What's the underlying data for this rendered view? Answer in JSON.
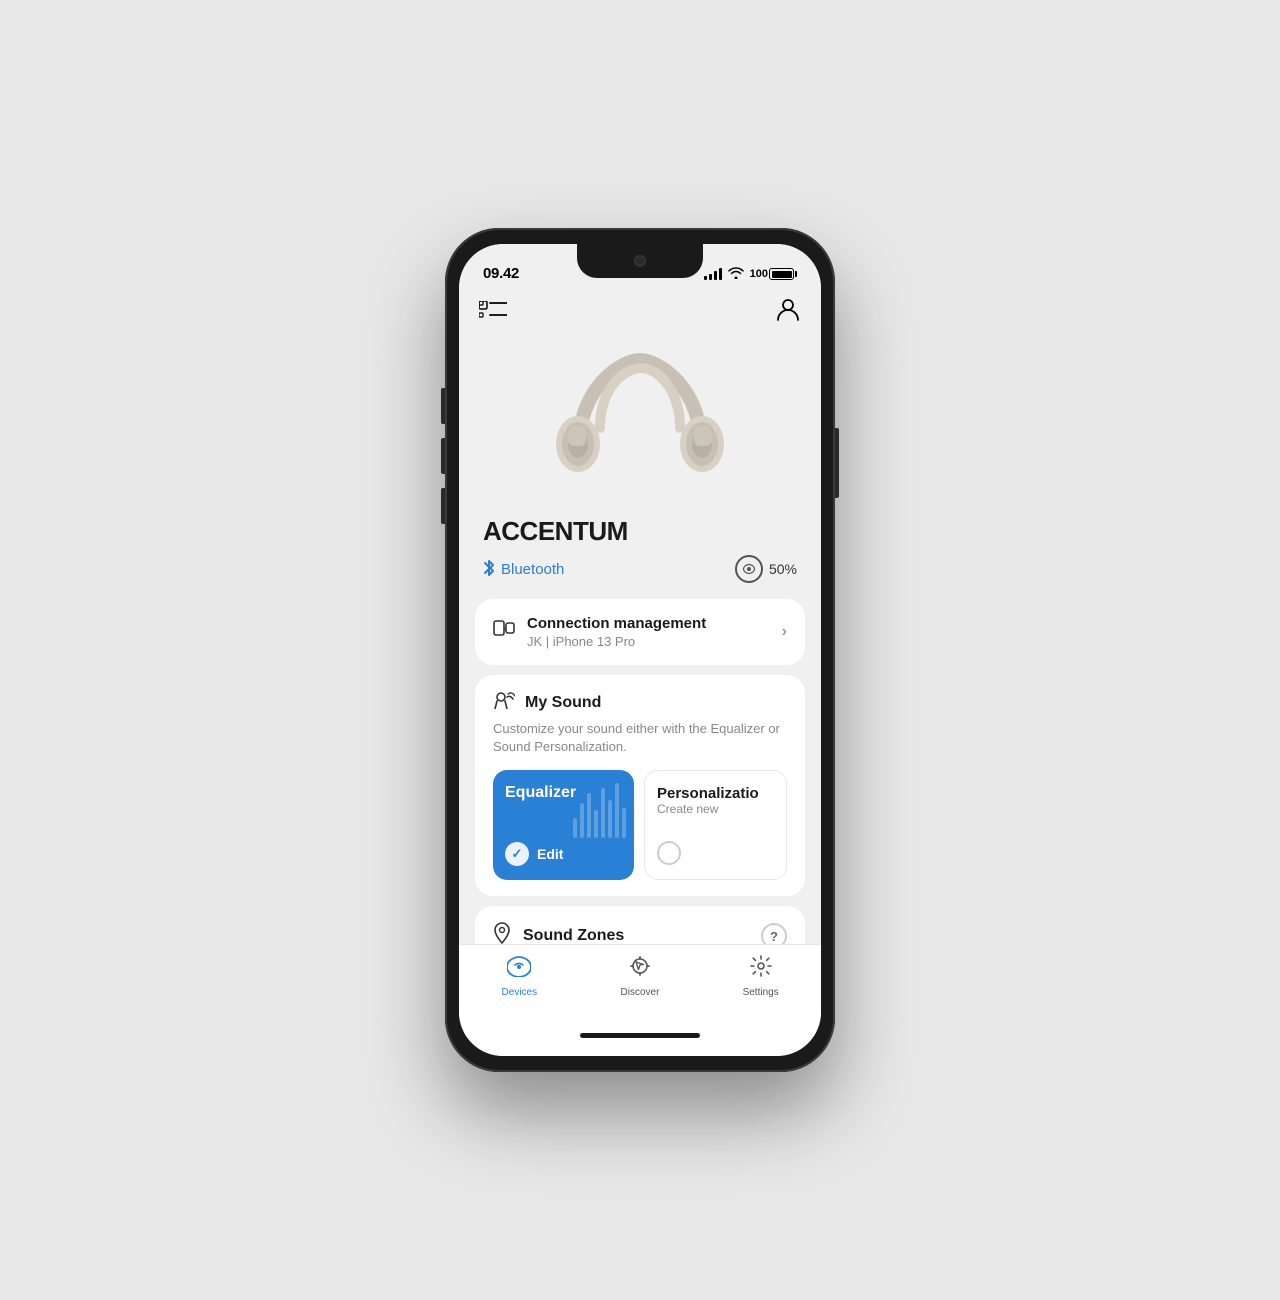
{
  "phone": {
    "status_bar": {
      "time": "09.42",
      "battery_label": "100",
      "signal_bars": [
        3,
        5,
        7,
        10,
        12
      ]
    },
    "header": {
      "menu_icon_label": "menu",
      "profile_icon_label": "profile"
    },
    "device": {
      "name": "ACCENTUM",
      "connection_type": "Bluetooth",
      "battery_percent": "50%"
    },
    "connection_card": {
      "title": "Connection management",
      "subtitle": "JK | iPhone 13 Pro"
    },
    "sound_card": {
      "title": "My Sound",
      "description": "Customize your sound either with the Equalizer or Sound Personalization.",
      "equalizer_label": "Equalizer",
      "equalizer_edit": "Edit",
      "personalization_label": "Personalizatio",
      "personalization_subtitle": "Create new"
    },
    "sound_zones": {
      "title": "Sound Zones"
    },
    "bottom_nav": {
      "devices_label": "Devices",
      "discover_label": "Discover",
      "settings_label": "Settings"
    }
  }
}
